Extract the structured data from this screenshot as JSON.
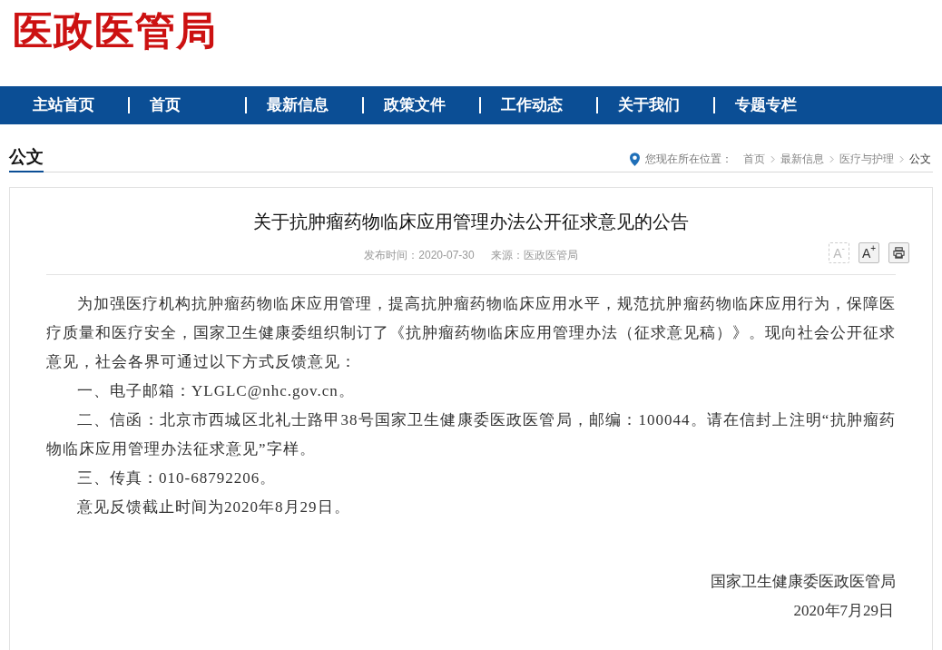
{
  "site_title": "医政医管局",
  "nav": [
    {
      "label": "主站首页"
    },
    {
      "label": "首页"
    },
    {
      "label": "最新信息"
    },
    {
      "label": "政策文件"
    },
    {
      "label": "工作动态"
    },
    {
      "label": "关于我们"
    },
    {
      "label": "专题专栏"
    }
  ],
  "section_title": "公文",
  "breadcrumb": {
    "label": "您现在所在位置：",
    "items": [
      {
        "label": "首页"
      },
      {
        "label": "最新信息"
      },
      {
        "label": "医疗与护理"
      },
      {
        "label": "公文"
      }
    ]
  },
  "article": {
    "title": "关于抗肿瘤药物临床应用管理办法公开征求意见的公告",
    "meta": [
      "发布时间：2020-07-30",
      "来源：医政医管局"
    ],
    "font_buttons": [
      {
        "kind": "decrease",
        "label": "A",
        "sign": "-",
        "disabled": true
      },
      {
        "kind": "increase",
        "label": "A",
        "sign": "+",
        "disabled": false
      },
      {
        "kind": "print"
      }
    ],
    "paragraphs": [
      {
        "text": "为加强医疗机构抗肿瘤药物临床应用管理，提高抗肿瘤药物临床应用水平，规范抗肿瘤药物临床应用行为，保障医疗质量和医疗安全，国家卫生健康委组织制订了《抗肿瘤药物临床应用管理办法（征求意见稿）》。现向社会公开征求意见，社会各界可通过以下方式反馈意见："
      },
      {
        "text": "一、电子邮箱：YLGLC@nhc.gov.cn。"
      },
      {
        "text": "二、信函：北京市西城区北礼士路甲38号国家卫生健康委医政医管局，邮编：100044。请在信封上注明“抗肿瘤药物临床应用管理办法征求意见”字样。"
      },
      {
        "text": "三、传真：010-68792206。"
      },
      {
        "text": "意见反馈截止时间为2020年8月29日。"
      }
    ],
    "signature": [
      "国家卫生健康委医政医管局",
      "2020年7月29日"
    ]
  }
}
